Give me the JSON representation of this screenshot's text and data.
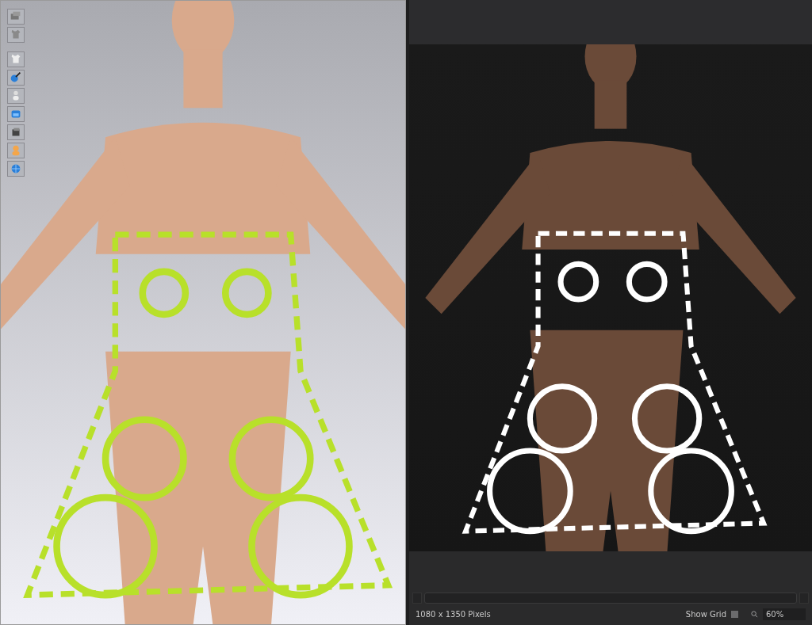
{
  "status_bar": {
    "size": "1080 x 1350 Pixels",
    "show_grid": {
      "label": "Show Grid",
      "checked": false
    },
    "zoom": "60%"
  }
}
